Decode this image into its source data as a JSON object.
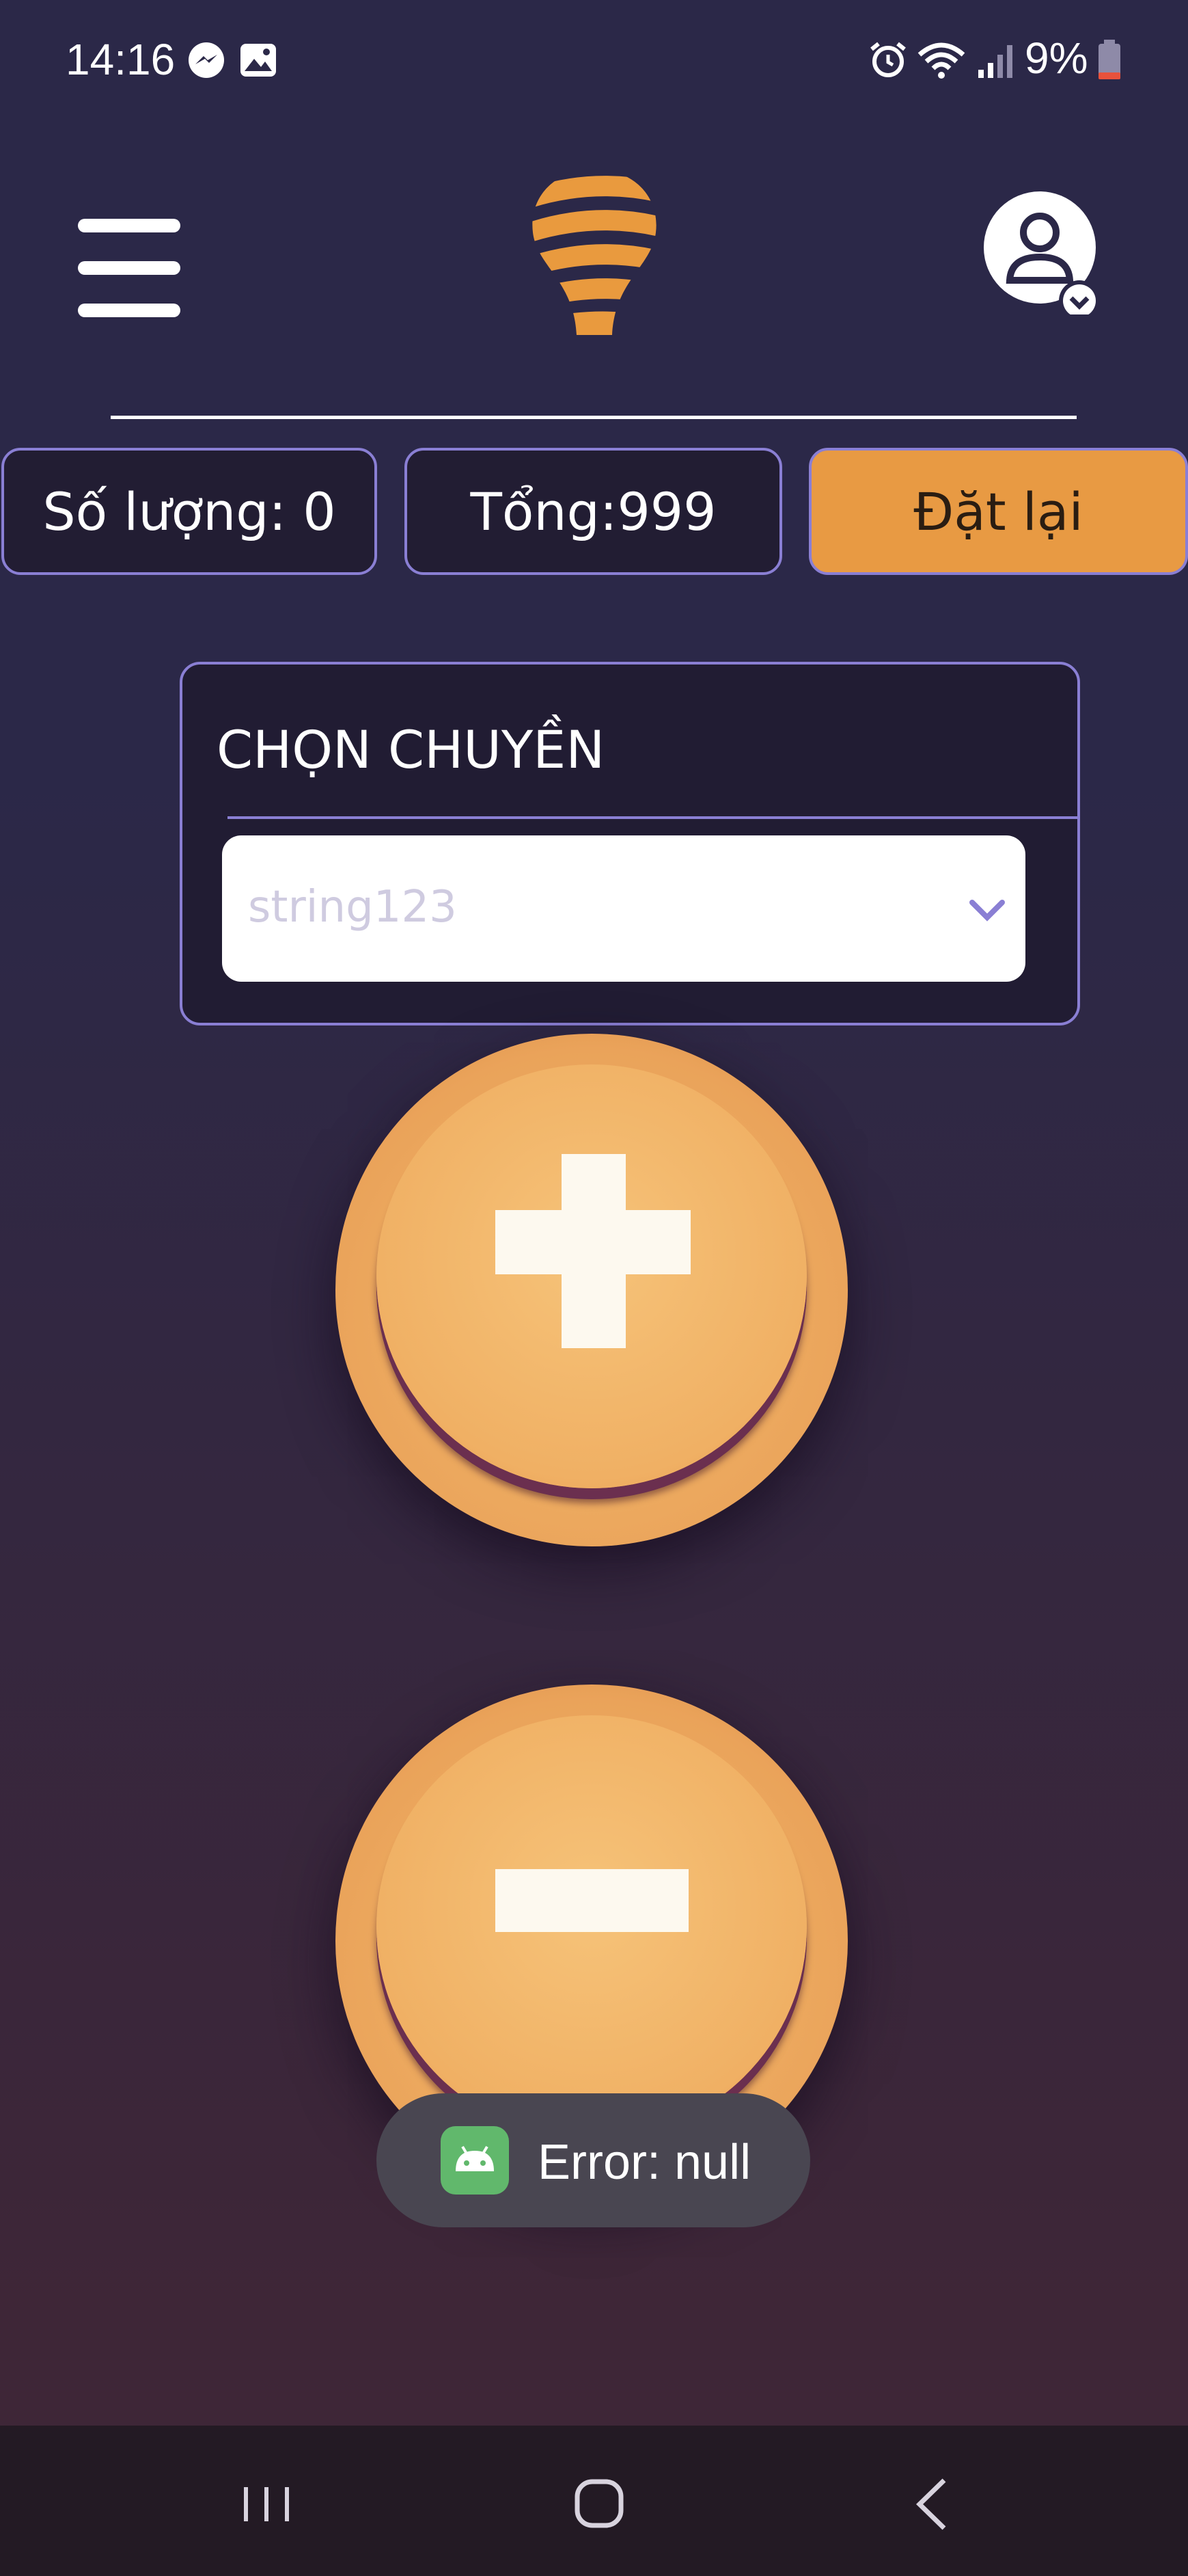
{
  "status_bar": {
    "time": "14:16",
    "battery": "9%"
  },
  "header": {
    "menu_icon": "hamburger-icon",
    "logo_icon": "lightbulb-logo",
    "account_icon": "account-icon"
  },
  "stats": {
    "quantity": "Số lượng: 0",
    "total": "Tổng:999",
    "reset_label": "Đặt lại"
  },
  "selector": {
    "title": "CHỌN CHUYỀN",
    "value": "string123"
  },
  "controls": {
    "increment_icon": "plus-icon",
    "decrement_icon": "minus-icon"
  },
  "toast": {
    "message": "Error: null"
  },
  "nav": {
    "recent": "recent-apps-icon",
    "home": "home-icon",
    "back": "back-icon"
  },
  "colors": {
    "accent": "#e89a43",
    "border": "#8a7fd4",
    "background": "#2b2848"
  }
}
